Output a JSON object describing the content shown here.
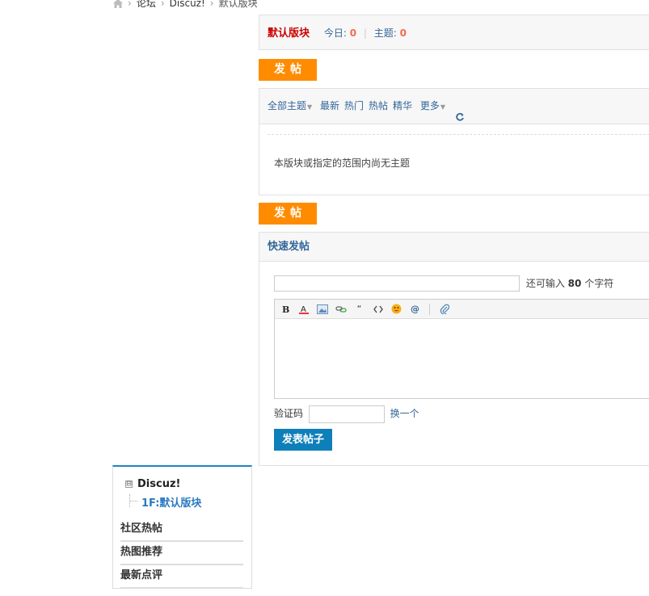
{
  "breadcrumb": {
    "items": [
      "论坛",
      "Discuz!",
      "默认版块"
    ],
    "separator": "›"
  },
  "forum": {
    "name": "默认版块",
    "today_label": "今日:",
    "today_value": "0",
    "threads_label": "主题:",
    "threads_value": "0",
    "stat_separator": "|"
  },
  "post_button_label": "发帖",
  "filters": {
    "all": "全部主题",
    "items": [
      "最新",
      "热门",
      "热帖",
      "精华"
    ],
    "more": "更多"
  },
  "empty_message": "本版块或指定的范围内尚无主题",
  "quick_post": {
    "title": "快速发帖",
    "hint_prefix": "还可输入",
    "hint_count": "80",
    "hint_suffix": "个字符",
    "subject_value": "",
    "editor_tools": [
      "bold-icon",
      "font-color-icon",
      "image-icon",
      "link-icon",
      "quote-icon",
      "code-icon",
      "smiley-icon",
      "at-icon",
      "attachment-icon"
    ],
    "captcha_label": "验证码",
    "captcha_value": "",
    "captcha_refresh": "换一个",
    "submit_label": "发表帖子"
  },
  "sidebar": {
    "root": "Discuz!",
    "root_toggle": "⊟",
    "child": "1F:默认版块",
    "links": [
      "社区热帖",
      "热图推荐",
      "最新点评"
    ]
  },
  "colors": {
    "forum_name": "#cc0000",
    "stat_number": "#f26c4f",
    "link": "#336699",
    "post_button": "#ff8c00",
    "submit_button": "#0e7fb8",
    "sidebar_top_border": "#2383c6"
  }
}
